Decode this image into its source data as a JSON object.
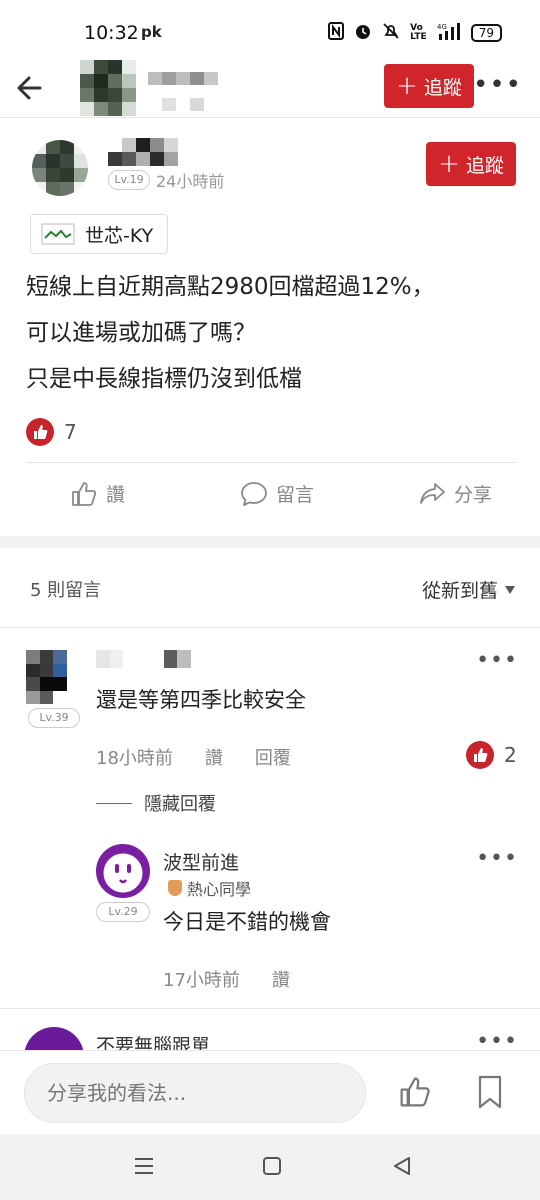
{
  "status_bar": {
    "time": "10:32",
    "app_badge": "pk",
    "battery": "79",
    "network": "4G"
  },
  "header": {
    "follow_label": "追蹤",
    "more_label": "•••"
  },
  "post": {
    "level": "Lv.19",
    "time": "24小時前",
    "follow_label": "追蹤",
    "stock_tag": "世芯-KY",
    "body_lines": [
      "短線上自近期高點2980回檔超過12%，",
      "可以進場或加碼了嗎？",
      "只是中長線指標仍沒到低檔"
    ],
    "like_count": "7",
    "actions": {
      "like": "讚",
      "comment": "留言",
      "share": "分享"
    }
  },
  "comments_header": {
    "count_label": "5 則留言",
    "sort_label": "從新到舊"
  },
  "comments": [
    {
      "level": "Lv.39",
      "text": "還是等第四季比較安全",
      "time": "18小時前",
      "like_label": "讚",
      "reply_label": "回覆",
      "like_count": "2",
      "hide_replies_label": "隱藏回覆",
      "replies": [
        {
          "name": "波型前進",
          "badge": "熱心同學",
          "level": "Lv.29",
          "text": "今日是不錯的機會",
          "time": "17小時前",
          "like_label": "讚"
        }
      ]
    },
    {
      "name": "不要無腦跟單"
    }
  ],
  "input_bar": {
    "placeholder": "分享我的看法..."
  },
  "colors": {
    "accent": "#d0262b",
    "like": "#c7242b",
    "reply_avatar": "#7b1fa2"
  }
}
